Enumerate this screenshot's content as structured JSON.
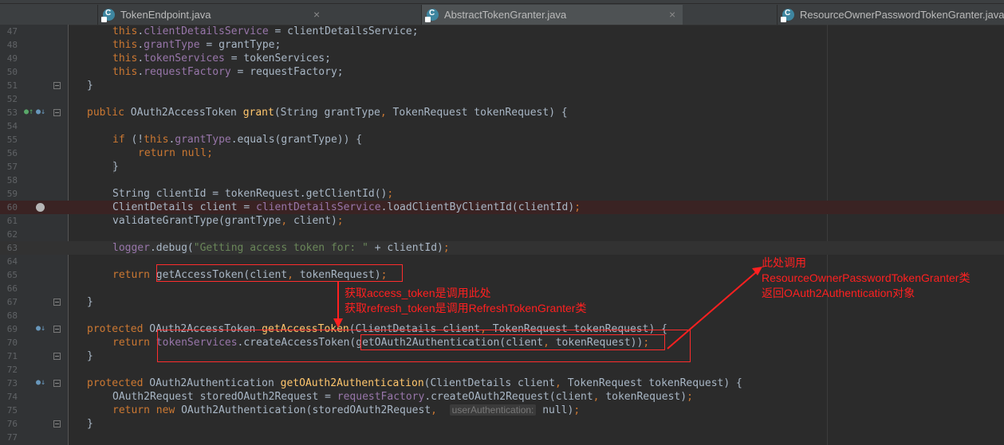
{
  "tabs": [
    {
      "label": "TokenEndpoint.java",
      "close": "×",
      "active": false,
      "icon": "java-class-icon"
    },
    {
      "label": "AbstractTokenGranter.java",
      "close": "×",
      "active": true,
      "icon": "java-class-icon"
    },
    {
      "label": "ResourceOwnerPasswordTokenGranter.java",
      "close": "",
      "active": false,
      "icon": "java-class-icon"
    }
  ],
  "lines": [
    {
      "n": "47"
    },
    {
      "n": "48"
    },
    {
      "n": "49"
    },
    {
      "n": "50"
    },
    {
      "n": "51"
    },
    {
      "n": "52"
    },
    {
      "n": "53"
    },
    {
      "n": "54"
    },
    {
      "n": "55"
    },
    {
      "n": "56"
    },
    {
      "n": "57"
    },
    {
      "n": "58"
    },
    {
      "n": "59"
    },
    {
      "n": "60"
    },
    {
      "n": "61"
    },
    {
      "n": "62"
    },
    {
      "n": "63"
    },
    {
      "n": "64"
    },
    {
      "n": "65"
    },
    {
      "n": "66"
    },
    {
      "n": "67"
    },
    {
      "n": "68"
    },
    {
      "n": "69"
    },
    {
      "n": "70"
    },
    {
      "n": "71"
    },
    {
      "n": "72"
    },
    {
      "n": "73"
    },
    {
      "n": "74"
    },
    {
      "n": "75"
    },
    {
      "n": "76"
    },
    {
      "n": "77"
    }
  ],
  "code": {
    "l47": [
      "this",
      ".",
      "clientDetailsService",
      " = clientDetailsService;"
    ],
    "l48": [
      "this",
      ".",
      "grantType",
      " = grantType;"
    ],
    "l49": [
      "this",
      ".",
      "tokenServices",
      " = tokenServices;"
    ],
    "l50": [
      "this",
      ".",
      "requestFactory",
      " = requestFactory;"
    ],
    "l51": [
      "}"
    ],
    "l53": [
      "public",
      " OAuth2AccessToken ",
      "grant",
      "(String grantType",
      ", ",
      "TokenRequest tokenRequest) {"
    ],
    "l55": [
      "if",
      " (!",
      "this",
      ".",
      "grantType",
      ".equals(grantType)) {"
    ],
    "l56": [
      "return null",
      ";"
    ],
    "l57": [
      "}"
    ],
    "l59": [
      "String clientId = tokenRequest.getClientId()",
      ";"
    ],
    "l60": [
      "ClientDetails client = ",
      "clientDetailsService",
      ".loadClientByClientId(clientId)",
      ";"
    ],
    "l61": [
      "validateGrantType(grantType",
      ", ",
      "client)",
      ";"
    ],
    "l63": [
      "logger",
      ".debug(",
      "\"Getting access token for: \"",
      " + clientId)",
      ";"
    ],
    "l65": [
      "return ",
      "getAccessToken(client",
      ", ",
      "tokenRequest)",
      ";"
    ],
    "l67": [
      "}"
    ],
    "l69": [
      "protected",
      " OAuth2AccessToken ",
      "getAccessToken",
      "(ClientDetails client",
      ", ",
      "TokenRequest tokenRequest) {"
    ],
    "l70": [
      "return ",
      "tokenServices",
      ".createAccessToken(",
      "getOAuth2Authentication(client",
      ", ",
      "tokenRequest))",
      ";"
    ],
    "l71": [
      "}"
    ],
    "l73": [
      "protected",
      " OAuth2Authentication ",
      "getOAuth2Authentication",
      "(ClientDetails client",
      ", ",
      "TokenRequest tokenRequest) {"
    ],
    "l74": [
      "OAuth2Request storedOAuth2Request = ",
      "requestFactory",
      ".createOAuth2Request(client",
      ", ",
      "tokenRequest)",
      ";"
    ],
    "l75": [
      "return new ",
      "OAuth2Authentication(storedOAuth2Request",
      ",  ",
      "userAuthentication:",
      " null)",
      ";"
    ],
    "l76": [
      "}"
    ]
  },
  "annotations": {
    "left": [
      "获取access_token是调用此处",
      "获取refresh_token是调用RefreshTokenGranter类"
    ],
    "right": [
      "此处调用",
      "ResourceOwnerPasswordTokenGranter类",
      "返回OAuth2Authentication对象"
    ]
  },
  "colors": {
    "annotation": "#ff2020",
    "keyword": "#cc7832",
    "field": "#9876aa",
    "method": "#ffc66d",
    "string": "#6a8759"
  }
}
